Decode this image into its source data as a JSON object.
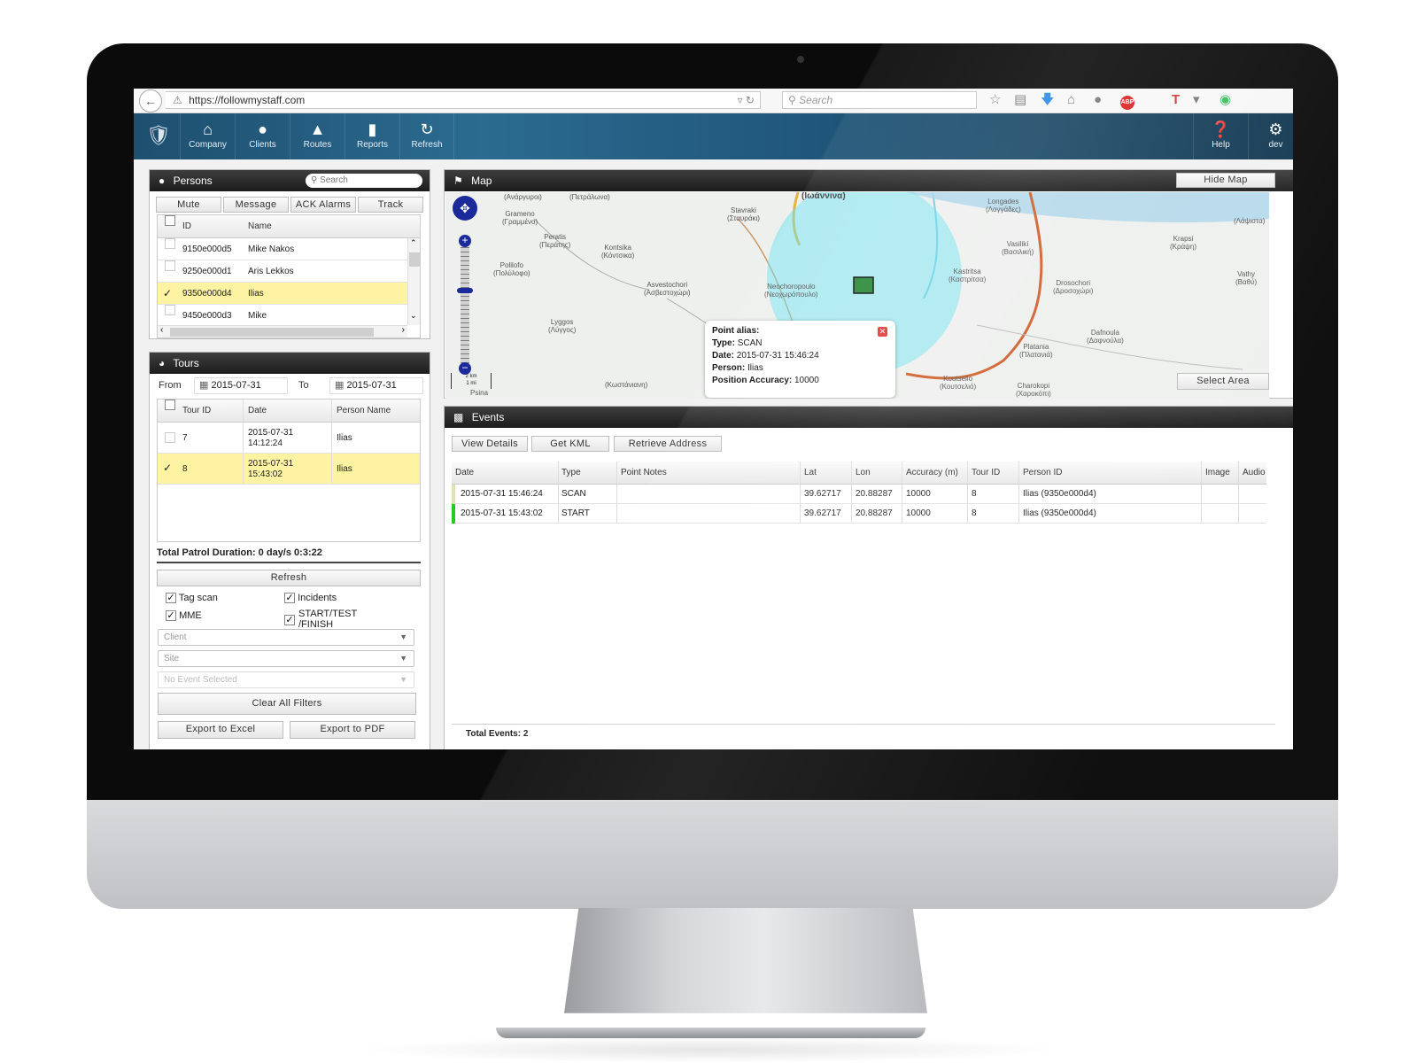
{
  "browser": {
    "url": "https://followmystaff.com",
    "search_placeholder": "Search",
    "back_glyph": "←"
  },
  "nav": {
    "items": [
      {
        "label": "Company",
        "icon": "home-icon"
      },
      {
        "label": "Clients",
        "icon": "user-icon"
      },
      {
        "label": "Routes",
        "icon": "road-icon"
      },
      {
        "label": "Reports",
        "icon": "chart-icon"
      },
      {
        "label": "Refresh",
        "icon": "refresh-icon"
      }
    ],
    "right_items": [
      {
        "label": "Help",
        "icon": "help-icon"
      },
      {
        "label": "dev",
        "icon": "gear-icon"
      }
    ]
  },
  "persons": {
    "title": "Persons",
    "search_placeholder": "Search",
    "buttons": [
      "Mute",
      "Message",
      "ACK Alarms",
      "Track"
    ],
    "columns": [
      "ID",
      "Name"
    ],
    "rows": [
      {
        "id": "9150e000d5",
        "name": "Mike Nakos",
        "checked": false
      },
      {
        "id": "9250e000d1",
        "name": "Aris Lekkos",
        "checked": false
      },
      {
        "id": "9350e000d4",
        "name": "Ilias",
        "checked": true
      },
      {
        "id": "9450e000d3",
        "name": "Mike",
        "checked": false
      }
    ]
  },
  "tours": {
    "title": "Tours",
    "from_label": "From",
    "to_label": "To",
    "from_date": "2015-07-31",
    "to_date": "2015-07-31",
    "columns": [
      "Tour ID",
      "Date",
      "Person Name"
    ],
    "rows": [
      {
        "tour_id": "7",
        "date_line1": "2015-07-31",
        "date_line2": "14:12:24",
        "person": "Ilias",
        "checked": false
      },
      {
        "tour_id": "8",
        "date_line1": "2015-07-31",
        "date_line2": "15:43:02",
        "person": "Ilias",
        "checked": true
      }
    ],
    "total_duration": "Total Patrol Duration: 0 day/s 0:3:22",
    "refresh_label": "Refresh",
    "filters": {
      "tag_scan": "Tag scan",
      "incidents": "Incidents",
      "mme": "MME",
      "start_test_line1": "START/TEST",
      "start_test_line2": "/FINISH",
      "client_placeholder": "Client",
      "site_placeholder": "Site",
      "event_placeholder": "No Event Selected",
      "clear_label": "Clear All Filters",
      "export_excel": "Export to Excel",
      "export_pdf": "Export to PDF"
    }
  },
  "map": {
    "title": "Map",
    "hide_label": "Hide Map",
    "select_area_label": "Select Area",
    "scale_km": "2 km",
    "scale_mi": "1 mi",
    "city_label": "(Ιωάννινα)",
    "places": [
      {
        "t1": "(Ανάργυροι)",
        "t2": ""
      },
      {
        "t1": "(Πετράλωνα)",
        "t2": ""
      },
      {
        "t1": "Grameno",
        "t2": "(Γραμμένο)"
      },
      {
        "t1": "Stavraki",
        "t2": "(Σταυράκι)"
      },
      {
        "t1": "Longades",
        "t2": "(Λογγάδες)"
      },
      {
        "t1": "(Λάψιστα)",
        "t2": ""
      },
      {
        "t1": "Peratis",
        "t2": "(Περάτης)"
      },
      {
        "t1": "Kontsika",
        "t2": "(Κόντσικα)"
      },
      {
        "t1": "Vasilikí",
        "t2": "(Βασιλική)"
      },
      {
        "t1": "Krapsi",
        "t2": "(Κράψη)"
      },
      {
        "t1": "Polilofo",
        "t2": "(Πολύλοφο)"
      },
      {
        "t1": "Kastritsa",
        "t2": "(Καστρίτσα)"
      },
      {
        "t1": "Vathy",
        "t2": "(Βαθύ)"
      },
      {
        "t1": "Asvestochori",
        "t2": "(Ασβεστοχώρι)"
      },
      {
        "t1": "Neochoropoulo",
        "t2": "(Νεοχωρόπουλο)"
      },
      {
        "t1": "Drosochori",
        "t2": "(Δροσοχώρι)"
      },
      {
        "t1": "Lyggos",
        "t2": "(Λύγγος)"
      },
      {
        "t1": "Platania",
        "t2": "(Πλατανιά)"
      },
      {
        "t1": "Dafnoula",
        "t2": "(Δαφνούλα)"
      },
      {
        "t1": "Koutselio",
        "t2": "(Κουτσελιό)"
      },
      {
        "t1": "Charokopi",
        "t2": "(Χαροκόπι)"
      },
      {
        "t1": "(Κωστάνιανη)",
        "t2": ""
      },
      {
        "t1": "Psina",
        "t2": ""
      }
    ],
    "popup": {
      "alias_label": "Point alias:",
      "alias_value": "",
      "type_label": "Type:",
      "type_value": "SCAN",
      "date_label": "Date:",
      "date_value": "2015-07-31 15:46:24",
      "person_label": "Person:",
      "person_value": "Ilias",
      "accuracy_label": "Position Accuracy:",
      "accuracy_value": "10000"
    }
  },
  "events": {
    "title": "Events",
    "buttons": [
      "View Details",
      "Get KML",
      "Retrieve Address"
    ],
    "columns": [
      "Date",
      "Type",
      "Point Notes",
      "Lat",
      "Lon",
      "Accuracy (m)",
      "Tour ID",
      "Person ID",
      "Image",
      "Audio"
    ],
    "rows": [
      {
        "date": "2015-07-31 15:46:24",
        "type": "SCAN",
        "notes": "",
        "lat": "39.62717",
        "lon": "20.88287",
        "accuracy": "10000",
        "tour_id": "8",
        "person_id": "Ilias (9350e000d4)",
        "marker_color": "#d9d9a0"
      },
      {
        "date": "2015-07-31 15:43:02",
        "type": "START",
        "notes": "",
        "lat": "39.62717",
        "lon": "20.88287",
        "accuracy": "10000",
        "tour_id": "8",
        "person_id": "Ilias (9350e000d4)",
        "marker_color": "#22cc22"
      }
    ],
    "total": "Total Events: 2"
  }
}
